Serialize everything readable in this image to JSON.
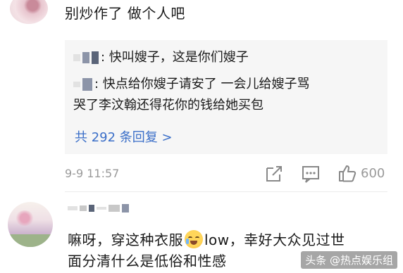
{
  "comment1": {
    "text": "别炒作了  做个人吧",
    "quotes": [
      {
        "text": ": 快叫嫂子，这是你们嫂子"
      },
      {
        "text": ": 快点给你嫂子请安了 一会儿给嫂子骂"
      },
      {
        "text": "哭了李汶翰还得花你的钱给她买包"
      }
    ],
    "replies_label": "共 292 条回复 >",
    "date": "9-9 11:57",
    "likes": "600",
    "icons": [
      "share-icon",
      "comment-icon",
      "like-icon"
    ]
  },
  "comment2": {
    "line1_a": "嘛呀，穿这种衣服",
    "line1_emoji": "crying-laughing-emoji",
    "line1_b": "low，幸好大众见过世",
    "line2": "面分清什么是低俗和性感"
  },
  "watermark": "头条 @热点娱乐组",
  "colors": {
    "link": "#3a6ec8",
    "meta": "#9a9a9a",
    "quote_bg": "#f6f6f6"
  }
}
